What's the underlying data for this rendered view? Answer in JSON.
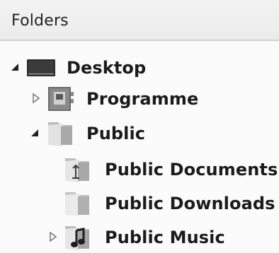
{
  "panel": {
    "title": "Folders"
  },
  "tree": {
    "desktop": {
      "label": "Desktop",
      "icon": "desktop-icon",
      "state": "expanded"
    },
    "programme": {
      "label": "Programme",
      "icon": "programs-folder-icon",
      "state": "collapsed"
    },
    "public": {
      "label": "Public",
      "icon": "folder-icon",
      "state": "expanded"
    },
    "public_documents": {
      "label": "Public Documents",
      "icon": "documents-folder-icon"
    },
    "public_downloads": {
      "label": "Public Downloads",
      "icon": "downloads-folder-icon"
    },
    "public_music": {
      "label": "Public Music",
      "icon": "music-folder-icon",
      "state": "collapsed"
    }
  }
}
